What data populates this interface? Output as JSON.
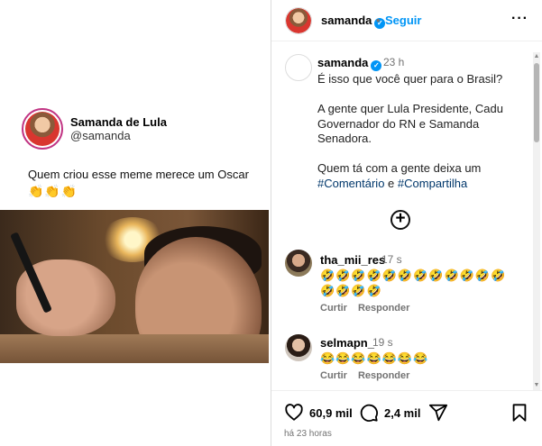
{
  "media": {
    "author_name": "Samanda de Lula",
    "author_handle": "@samanda",
    "text": "Quem criou esse meme merece um Oscar",
    "emojis": "👏👏👏"
  },
  "header": {
    "username": "samanda",
    "verified": true,
    "separator": "•",
    "follow_label": "Seguir",
    "more_label": "···"
  },
  "caption": {
    "username": "samanda",
    "time": "23 h",
    "text": "É isso que você quer para o Brasil?\n\nA gente quer Lula Presidente, Cadu Governador do RN e Samanda Senadora.\n\nQuem tá com a gente deixa um ",
    "hashtag1": "#Comentário",
    "connector": " e ",
    "hashtag2": "#Compartilha"
  },
  "load_more_label": "+",
  "comments": [
    {
      "username": "tha_mii_res",
      "time": "17 s",
      "text": "🤣🤣🤣🤣🤣🤣🤣🤣🤣🤣🤣🤣🤣🤣🤣🤣",
      "like_label": "Curtir",
      "reply_label": "Responder"
    },
    {
      "username": "selmapn_",
      "time": "19 s",
      "text": "😂😂😂😂😂😂😂",
      "like_label": "Curtir",
      "reply_label": "Responder"
    }
  ],
  "footer": {
    "likes": "60,9 mil",
    "comments": "2,4 mil",
    "timestamp": "há 23 horas"
  },
  "icons": [
    "verified-icon",
    "more-icon",
    "add-circle-icon",
    "heart-icon",
    "comment-icon",
    "share-icon",
    "save-icon"
  ],
  "colors": {
    "link": "#0095f6",
    "hashtag": "#00376b",
    "muted": "#737373",
    "border": "#dbdbdb"
  }
}
